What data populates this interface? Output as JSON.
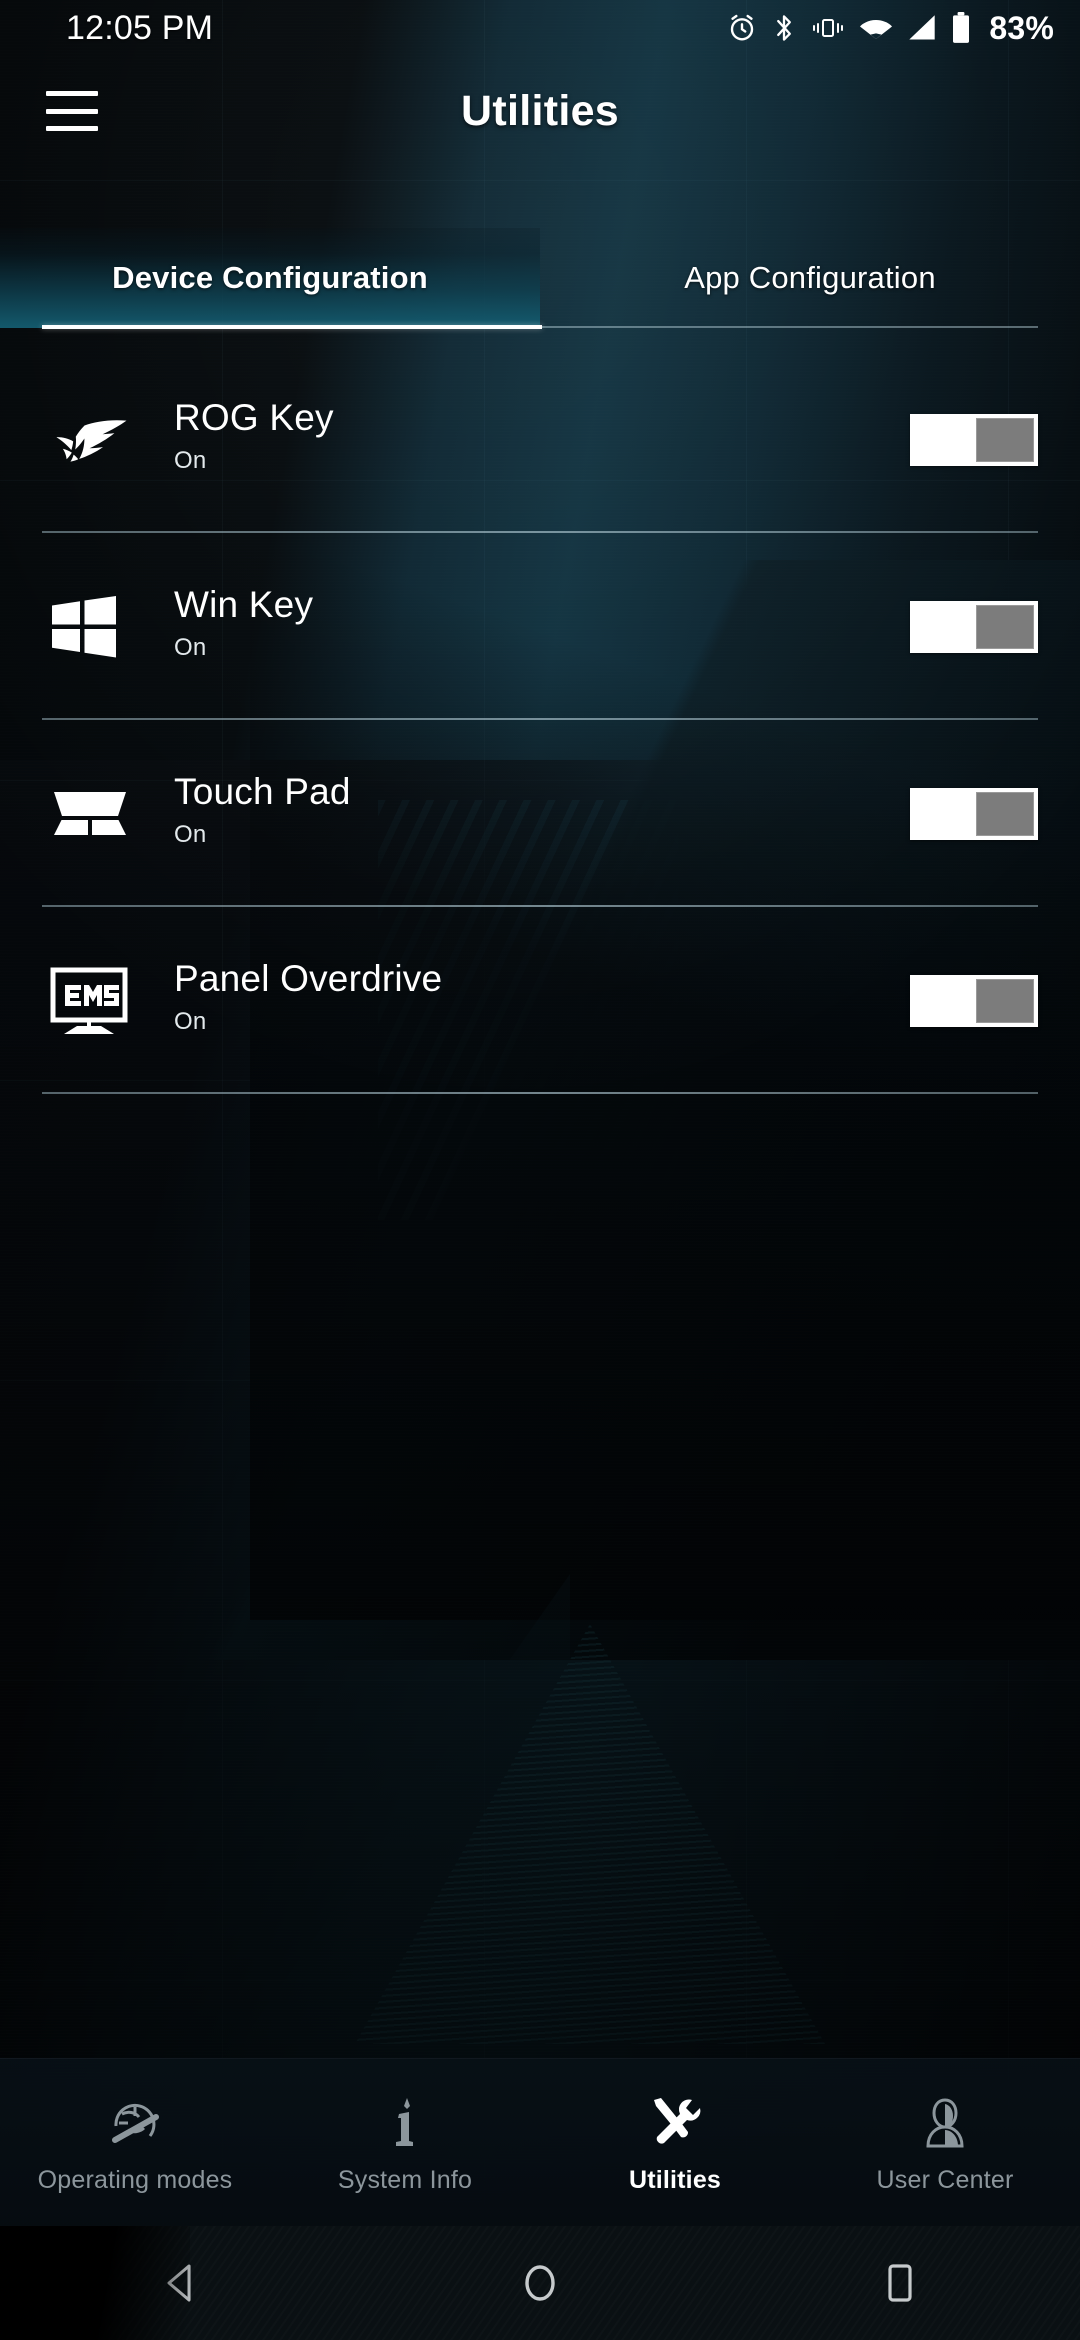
{
  "status_bar": {
    "time": "12:05 PM",
    "battery_percent": "83%",
    "icons": [
      "alarm-icon",
      "bluetooth-icon",
      "vibrate-icon",
      "wifi-icon",
      "cellular-signal-icon",
      "battery-icon"
    ]
  },
  "app_bar": {
    "menu_icon": "hamburger-menu-icon",
    "title": "Utilities"
  },
  "tabs": {
    "active_index": 0,
    "items": [
      {
        "label": "Device Configuration"
      },
      {
        "label": "App Configuration"
      }
    ]
  },
  "device_configuration": {
    "rows": [
      {
        "icon": "rog-logo-icon",
        "title": "ROG Key",
        "status": "On",
        "toggle_on": true
      },
      {
        "icon": "windows-logo-icon",
        "title": "Win Key",
        "status": "On",
        "toggle_on": true
      },
      {
        "icon": "touchpad-icon",
        "title": "Touch Pad",
        "status": "On",
        "toggle_on": true
      },
      {
        "icon": "monitor-3ms-icon",
        "title": "Panel Overdrive",
        "status": "On",
        "toggle_on": true
      }
    ]
  },
  "bottom_nav": {
    "active_index": 2,
    "items": [
      {
        "label": "Operating modes",
        "icon": "helmet-gauge-icon"
      },
      {
        "label": "System Info",
        "icon": "info-icon"
      },
      {
        "label": "Utilities",
        "icon": "tools-icon"
      },
      {
        "label": "User Center",
        "icon": "user-person-icon"
      }
    ]
  },
  "system_nav": {
    "back": "back-triangle-icon",
    "home": "home-circle-icon",
    "recents": "recents-square-icon"
  },
  "colors": {
    "accent_teal": "#145d71",
    "background_dark": "#05090c",
    "text_primary": "#ffffff",
    "text_muted": "#8c969c",
    "toggle_track": "#ffffff",
    "toggle_thumb": "#7c7c7c"
  }
}
